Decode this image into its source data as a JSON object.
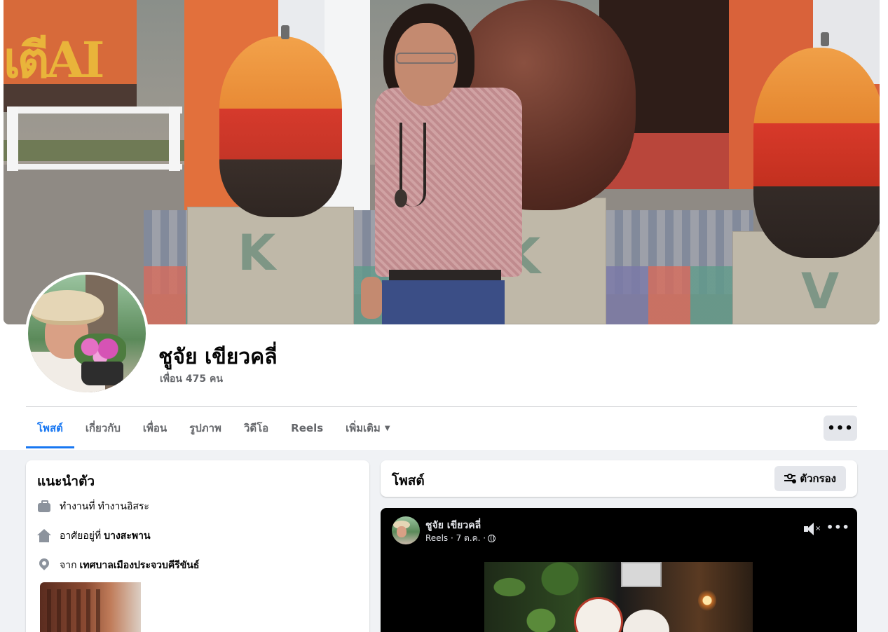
{
  "profile": {
    "name": "ชูจัย เขียวคลี่",
    "friends": "เพื่อน 475 คน"
  },
  "cover": {
    "sign_text": "เตีAI"
  },
  "tabs": [
    {
      "label": "โพสต์",
      "active": true
    },
    {
      "label": "เกี่ยวกับ",
      "active": false
    },
    {
      "label": "เพื่อน",
      "active": false
    },
    {
      "label": "รูปภาพ",
      "active": false
    },
    {
      "label": "วิดีโอ",
      "active": false
    },
    {
      "label": "Reels",
      "active": false
    },
    {
      "label": "เพิ่มเติม",
      "active": false
    }
  ],
  "more_button": {
    "label": "•••",
    "icon": "more-horizontal-icon"
  },
  "intro": {
    "title": "แนะนำตัว",
    "work": {
      "prefix": "ทำงานที่",
      "value": "ทำงานอิสระ",
      "icon": "briefcase-icon"
    },
    "lives": {
      "prefix": "อาศัยอยู่ที่",
      "value": "บางสะพาน",
      "icon": "home-icon"
    },
    "from": {
      "prefix": "จาก",
      "value": "เทศบาลเมืองประจวบคีรีขันธ์",
      "icon": "location-pin-icon"
    }
  },
  "posts": {
    "title": "โพสต์",
    "filter_label": "ตัวกรอง",
    "filter_icon": "filter-icon"
  },
  "post": {
    "author": "ชูจัย เขียวคลี่",
    "meta": "Reels · 7 ต.ค. ·",
    "mute_icon": "speaker-muted-icon",
    "more_label": "•••"
  },
  "colors": {
    "accent": "#1877f2",
    "background": "#f0f2f5",
    "secondary_text": "#65676b"
  }
}
